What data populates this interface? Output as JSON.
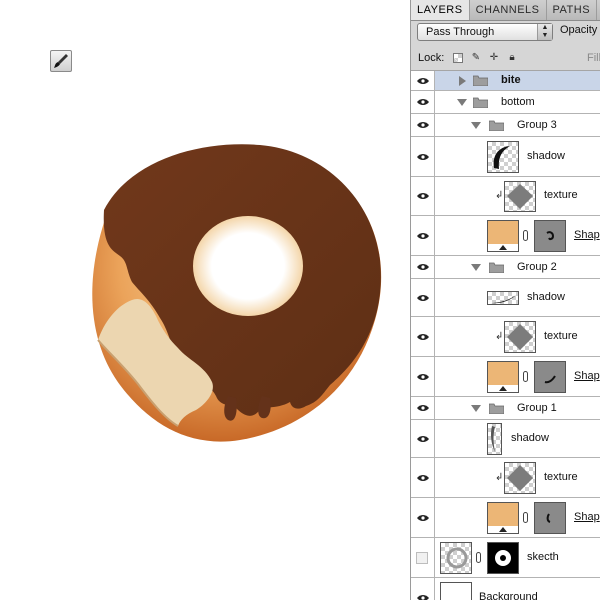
{
  "panel": {
    "tabs": [
      {
        "label": "LAYERS",
        "active": true
      },
      {
        "label": "CHANNELS",
        "active": false
      },
      {
        "label": "PATHS",
        "active": false
      }
    ],
    "blend_mode": "Pass Through",
    "opacity_label": "Opacity",
    "lock_label": "Lock:",
    "fill_label": "Fill"
  },
  "layers": [
    {
      "name": "bite",
      "kind": "group",
      "selected": true,
      "expanded": false
    },
    {
      "name": "bottom",
      "kind": "group",
      "expanded": true
    },
    {
      "name": "Group 3",
      "kind": "group",
      "expanded": true
    },
    {
      "name": "shadow",
      "kind": "layer"
    },
    {
      "name": "texture",
      "kind": "layer",
      "clipped": true
    },
    {
      "name": "Shap",
      "kind": "shape"
    },
    {
      "name": "Group 2",
      "kind": "group",
      "expanded": true
    },
    {
      "name": "shadow",
      "kind": "layer"
    },
    {
      "name": "texture",
      "kind": "layer",
      "clipped": true
    },
    {
      "name": "Shap",
      "kind": "shape"
    },
    {
      "name": "Group 1",
      "kind": "group",
      "expanded": true
    },
    {
      "name": "shadow",
      "kind": "layer"
    },
    {
      "name": "texture",
      "kind": "layer",
      "clipped": true
    },
    {
      "name": "Shap",
      "kind": "shape"
    },
    {
      "name": "skecth",
      "kind": "masked",
      "visible": false
    },
    {
      "name": "Background",
      "kind": "background"
    }
  ],
  "colors": {
    "chocolate": "#6b3418",
    "dough_light": "#f2c07e",
    "dough_dark": "#c9661f",
    "bite_cream": "#ecd6b0",
    "shape_swatch": "#ecb676",
    "selection": "#c9d5e8"
  },
  "icons": {
    "tool": "brush-icon",
    "visibility": "eye-icon",
    "group": "folder-icon"
  }
}
